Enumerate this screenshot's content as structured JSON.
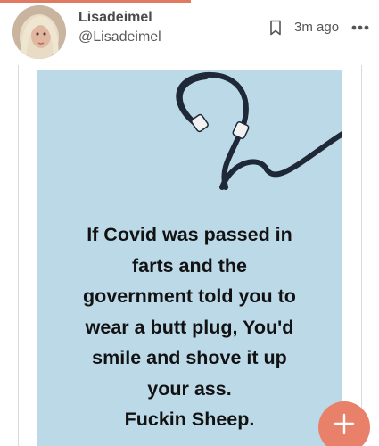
{
  "post": {
    "author": {
      "display_name": "Lisadeimel",
      "handle": "@Lisadeimel"
    },
    "timestamp": "3m ago"
  },
  "meme": {
    "lines": [
      "If Covid was passed in",
      "farts and the",
      "government told you to",
      "wear a butt plug,  You'd",
      "smile and shove it up",
      "your ass.",
      "Fuckin Sheep."
    ]
  },
  "icons": {
    "bookmark": "bookmark-icon",
    "more": "more-options-icon",
    "fab": "plus-icon"
  },
  "colors": {
    "accent": "#e07a62",
    "fab": "#e8806a",
    "meme_background": "#bcd9e8"
  }
}
